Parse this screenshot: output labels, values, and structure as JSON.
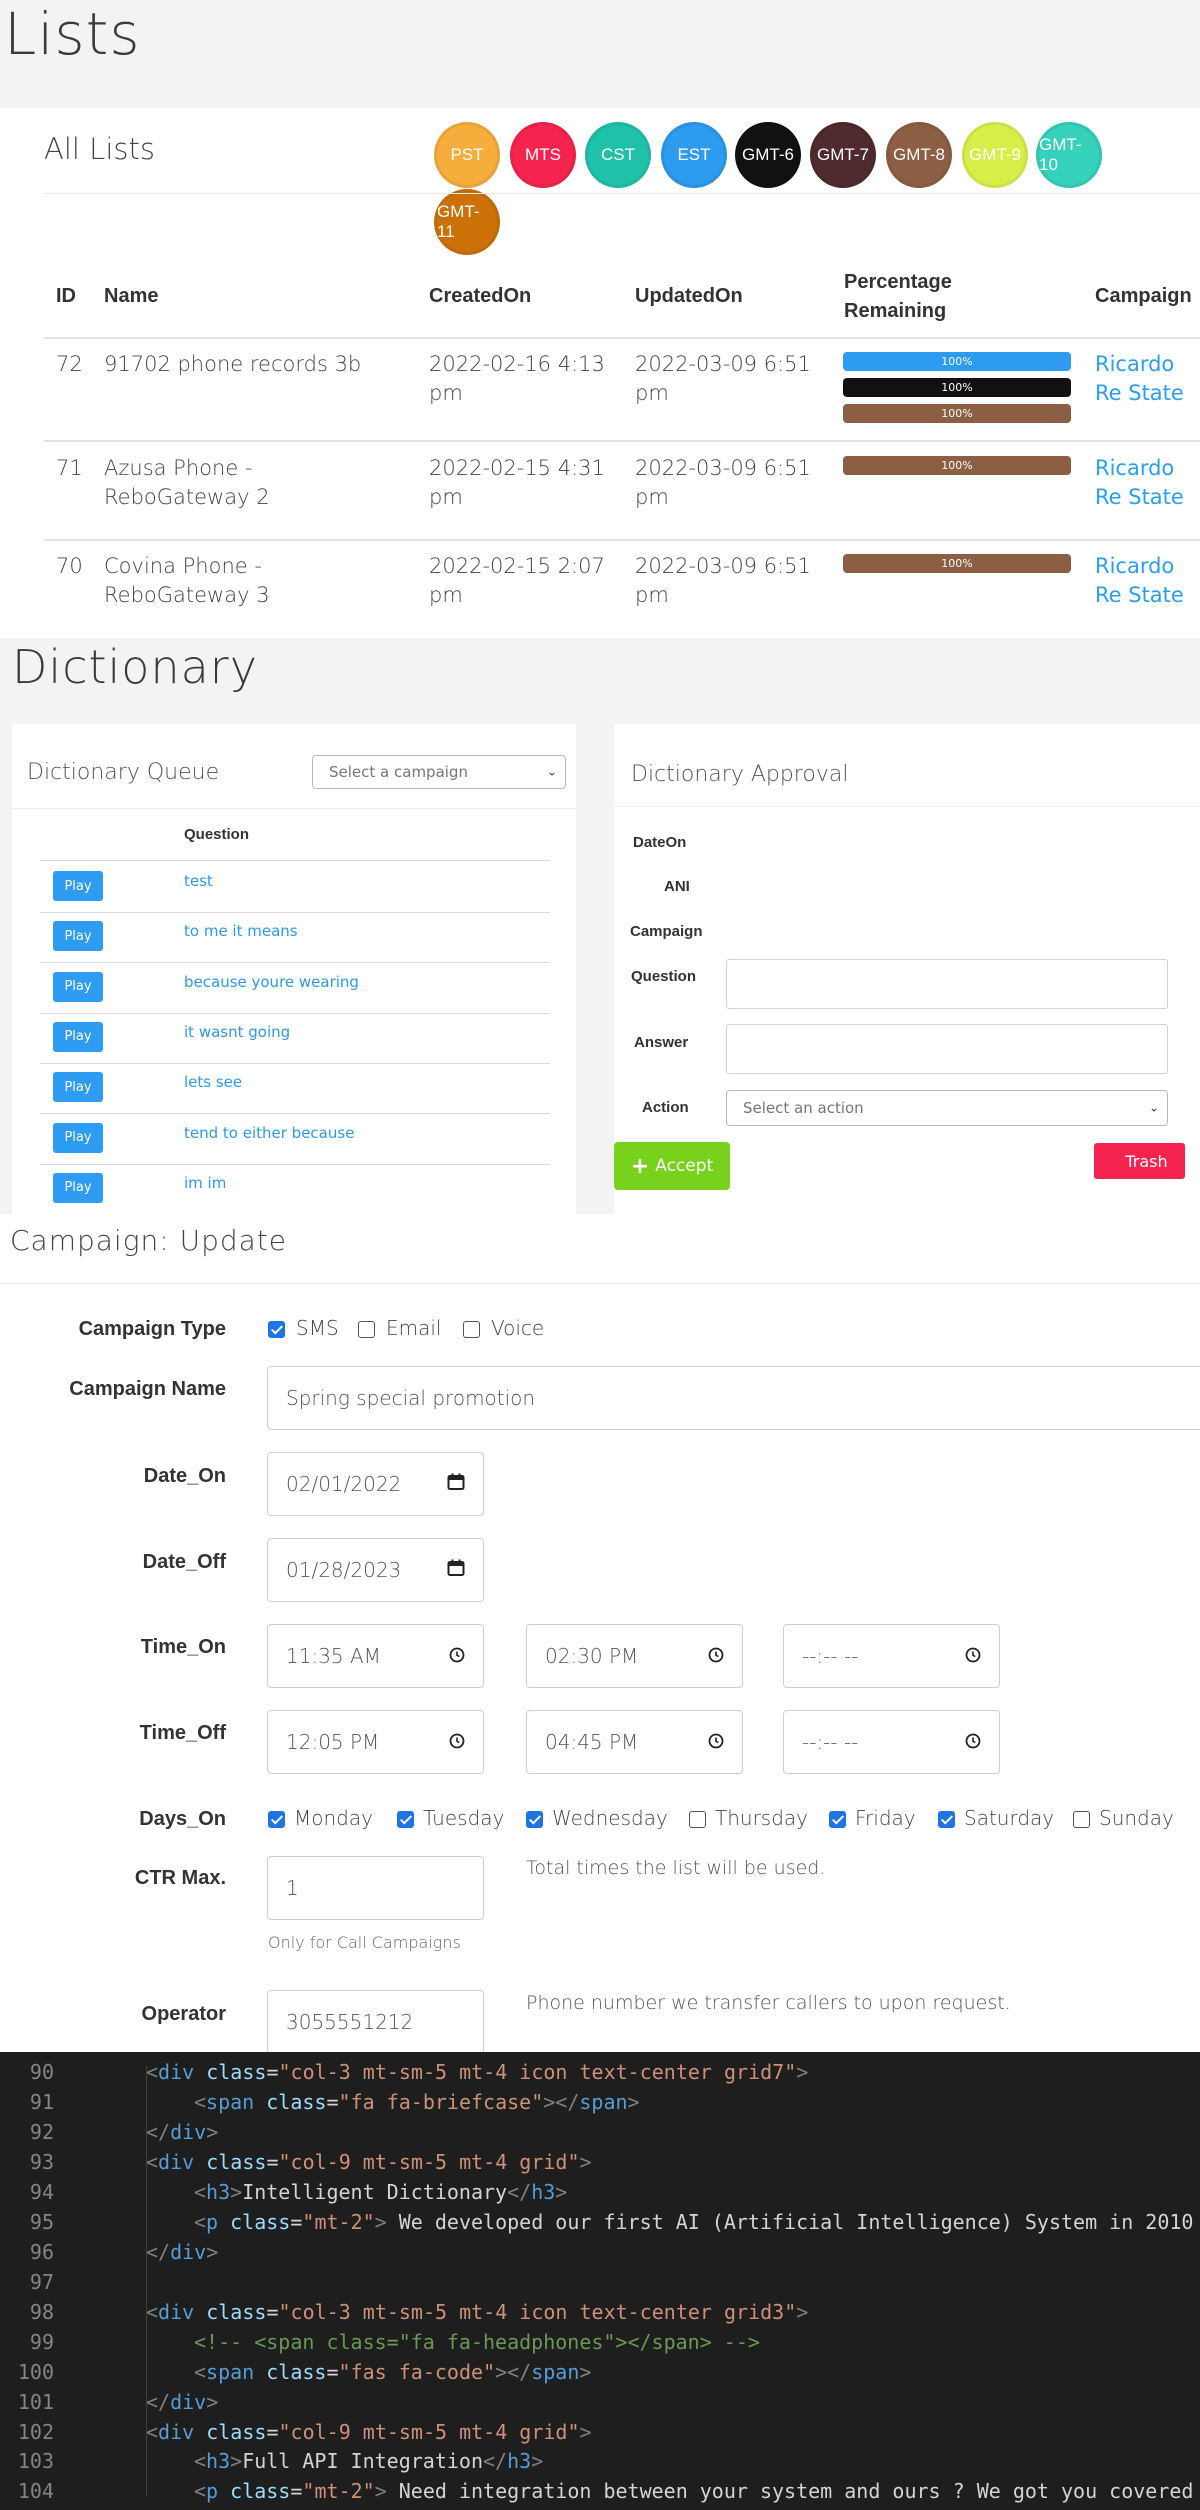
{
  "lists": {
    "title": "Lists",
    "card_title": "All Lists",
    "timezones": [
      {
        "label": "PST",
        "color": "#f6ad3c"
      },
      {
        "label": "MTS",
        "color": "#f5244e"
      },
      {
        "label": "CST",
        "color": "#1fc2a9"
      },
      {
        "label": "EST",
        "color": "#2d9bf0"
      },
      {
        "label": "GMT-6",
        "color": "#131014"
      },
      {
        "label": "GMT-7",
        "color": "#4e2a2e"
      },
      {
        "label": "GMT-8",
        "color": "#8c5f44"
      },
      {
        "label": "GMT-9",
        "color": "#d8ee48"
      },
      {
        "label": "GMT-10",
        "color": "#35d1bb"
      },
      {
        "label": "GMT-11",
        "color": "#cc7108"
      }
    ],
    "columns": [
      "ID",
      "Name",
      "CreatedOn",
      "UpdatedOn",
      "Percentage Remaining",
      "Campaign"
    ],
    "rows": [
      {
        "id": "72",
        "name": "91702 phone records 3b",
        "created": "2022-02-16 4:13 pm",
        "updated": "2022-03-09 6:51 pm",
        "bars": [
          {
            "value": "100%",
            "color": "#2d9bf0"
          },
          {
            "value": "100%",
            "color": "#131014"
          },
          {
            "value": "100%",
            "color": "#8c5f44"
          }
        ],
        "campaign": "Ricardo Re State"
      },
      {
        "id": "71",
        "name": "Azusa Phone - ReboGateway 2",
        "created": "2022-02-15 4:31 pm",
        "updated": "2022-03-09 6:51 pm",
        "bars": [
          {
            "value": "100%",
            "color": "#8c5f44"
          }
        ],
        "campaign": "Ricardo Re State"
      },
      {
        "id": "70",
        "name": "Covina Phone - ReboGateway 3",
        "created": "2022-02-15 2:07 pm",
        "updated": "2022-03-09 6:51 pm",
        "bars": [
          {
            "value": "100%",
            "color": "#8c5f44"
          }
        ],
        "campaign": "Ricardo Re State"
      }
    ]
  },
  "dictionary": {
    "title": "Dictionary",
    "queue": {
      "title": "Dictionary Queue",
      "select_value": "Select a campaign",
      "column": "Question",
      "play_label": "Play",
      "items": [
        "test",
        "to me it means",
        "because youre wearing",
        "it wasnt going",
        "lets see",
        "tend to either because",
        "im im"
      ]
    },
    "approval": {
      "title": "Dictionary Approval",
      "labels": {
        "date_on": "DateOn",
        "ani": "ANI",
        "campaign": "Campaign",
        "question": "Question",
        "answer": "Answer",
        "action": "Action"
      },
      "question_value": "",
      "answer_value": "",
      "action_select": "Select an action",
      "accept_label": "Accept",
      "trash_label": "Trash"
    }
  },
  "campaign": {
    "title": "Campaign: Update",
    "type_label": "Campaign Type",
    "types": [
      {
        "label": "SMS",
        "checked": true
      },
      {
        "label": "Email",
        "checked": false
      },
      {
        "label": "Voice",
        "checked": false
      }
    ],
    "name_label": "Campaign Name",
    "name_value": "Spring special promotion",
    "date_on_label": "Date_On",
    "date_on": "02/01/2022",
    "date_off_label": "Date_Off",
    "date_off": "01/28/2023",
    "time_on_label": "Time_On",
    "time_on": [
      "11:35 AM",
      "02:30 PM",
      "--:-- --"
    ],
    "time_off_label": "Time_Off",
    "time_off": [
      "12:05 PM",
      "04:45 PM",
      "--:-- --"
    ],
    "days_label": "Days_On",
    "days": [
      {
        "label": "Monday",
        "checked": true
      },
      {
        "label": "Tuesday",
        "checked": true
      },
      {
        "label": "Wednesday",
        "checked": true
      },
      {
        "label": "Thursday",
        "checked": false
      },
      {
        "label": "Friday",
        "checked": true
      },
      {
        "label": "Saturday",
        "checked": true
      },
      {
        "label": "Sunday",
        "checked": false
      }
    ],
    "ctr_label": "CTR Max.",
    "ctr_value": "1",
    "ctr_help": "Total times the list will be used.",
    "ctr_note": "Only for Call Campaigns",
    "operator_label": "Operator",
    "operator_value": "3055551212",
    "operator_help": "Phone number we transfer callers to upon request."
  },
  "code": {
    "lines": [
      {
        "n": "90",
        "indent": 1,
        "text": "<div class=\"col-3 mt-sm-5 mt-4 icon text-center grid7\">"
      },
      {
        "n": "91",
        "indent": 2,
        "text": "<span class=\"fa fa-briefcase\"></span>"
      },
      {
        "n": "92",
        "indent": 1,
        "text": "</div>"
      },
      {
        "n": "93",
        "indent": 1,
        "text": "<div class=\"col-9 mt-sm-5 mt-4 grid\">"
      },
      {
        "n": "94",
        "indent": 2,
        "text": "<h3>Intelligent Dictionary</h3>"
      },
      {
        "n": "95",
        "indent": 2,
        "text": "<p class=\"mt-2\"> We developed our first AI (Artificial Intelligence) System in 2010"
      },
      {
        "n": "96",
        "indent": 1,
        "text": "</div>"
      },
      {
        "n": "97",
        "indent": 0,
        "text": ""
      },
      {
        "n": "98",
        "indent": 1,
        "text": "<div class=\"col-3 mt-sm-5 mt-4 icon text-center grid3\">"
      },
      {
        "n": "99",
        "indent": 2,
        "text": "<!-- <span class=\"fa fa-headphones\"></span> -->"
      },
      {
        "n": "100",
        "indent": 2,
        "text": "<span class=\"fas fa-code\"></span>"
      },
      {
        "n": "101",
        "indent": 1,
        "text": "</div>"
      },
      {
        "n": "102",
        "indent": 1,
        "text": "<div class=\"col-9 mt-sm-5 mt-4 grid\">"
      },
      {
        "n": "103",
        "indent": 2,
        "text": "<h3>Full API Integration</h3>"
      },
      {
        "n": "104",
        "indent": 2,
        "text": "<p class=\"mt-2\"> Need integration between your system and ours ? We got you covered"
      }
    ]
  }
}
